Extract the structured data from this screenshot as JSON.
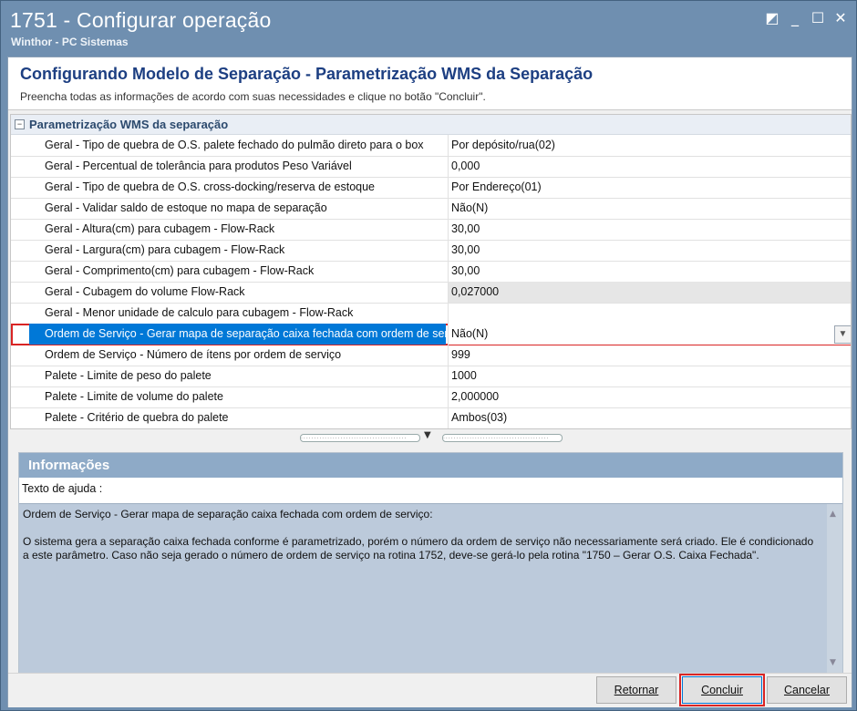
{
  "window": {
    "title": "1751 - Configurar operação",
    "subtitle": "Winthor - PC Sistemas",
    "controls": [
      "◩",
      "_",
      "☐",
      "✕"
    ]
  },
  "header": {
    "title": "Configurando Modelo de Separação - Parametrização WMS da Separação",
    "instructions": "Preencha todas as informações de acordo com suas necessidades e clique no botão \"Concluir\"."
  },
  "grid": {
    "category": "Parametrização WMS da separação",
    "rows": [
      {
        "name": "Geral - Tipo de quebra de O.S. palete fechado do pulmão direto para o box",
        "value": "Por depósito/rua(02)"
      },
      {
        "name": "Geral - Percentual de tolerância para produtos Peso Variável",
        "value": "0,000"
      },
      {
        "name": "Geral - Tipo de quebra de O.S. cross-docking/reserva de estoque",
        "value": "Por Endereço(01)"
      },
      {
        "name": "Geral - Validar saldo de estoque no mapa de separação",
        "value": "Não(N)"
      },
      {
        "name": "Geral - Altura(cm) para cubagem - Flow-Rack",
        "value": "30,00"
      },
      {
        "name": "Geral - Largura(cm) para cubagem - Flow-Rack",
        "value": "30,00"
      },
      {
        "name": "Geral - Comprimento(cm) para cubagem - Flow-Rack",
        "value": "30,00"
      },
      {
        "name": "Geral - Cubagem do volume Flow-Rack",
        "value": "0,027000"
      },
      {
        "name": "Geral - Menor unidade de calculo para cubagem - Flow-Rack",
        "value": ""
      },
      {
        "name": "Ordem de Serviço - Gerar mapa de separação caixa fechada com ordem de serviço",
        "value": "Não(N)"
      },
      {
        "name": "Ordem de Serviço - Número de ítens por ordem de serviço",
        "value": "999"
      },
      {
        "name": "Palete - Limite de peso do palete",
        "value": "1000"
      },
      {
        "name": "Palete - Limite de volume do palete",
        "value": "2,000000"
      },
      {
        "name": "Palete - Critério de quebra do palete",
        "value": "Ambos(03)"
      }
    ]
  },
  "info": {
    "header": "Informações",
    "help_label": "Texto de ajuda :",
    "help_title": "Ordem de Serviço - Gerar mapa de separação caixa fechada com ordem de serviço:",
    "help_body": "O sistema gera a separação caixa fechada conforme é parametrizado, porém o número da ordem de serviço não necessariamente será criado. Ele é condicionado a este parâmetro. Caso não seja gerado o número de ordem de serviço na rotina 1752, deve-se gerá-lo pela rotina \"1750 – Gerar O.S. Caixa Fechada\"."
  },
  "buttons": {
    "back": "Retornar",
    "finish": "Concluir",
    "cancel": "Cancelar"
  }
}
